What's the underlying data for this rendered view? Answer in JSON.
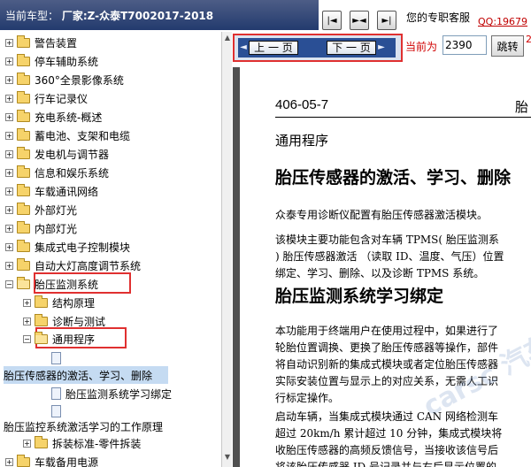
{
  "header": {
    "model_prefix": "当前车型：",
    "model_value": "厂家:Z-众泰T7002017-2018",
    "nav_buttons": [
      {
        "icon": "first-page-icon",
        "glyph": "|◄"
      },
      {
        "icon": "split-view-icon",
        "glyph": "►◄"
      },
      {
        "icon": "last-page-icon",
        "glyph": "►|"
      }
    ],
    "service_label": "您的专职客服",
    "qq": "QQ:19679"
  },
  "tree": {
    "items": [
      {
        "label": "警告装置",
        "expander": "+"
      },
      {
        "label": "停车辅助系统",
        "expander": "+"
      },
      {
        "label": "360°全景影像系统",
        "expander": "+"
      },
      {
        "label": "行车记录仪",
        "expander": "+"
      },
      {
        "label": "充电系统-概述",
        "expander": "+"
      },
      {
        "label": "蓄电池、支架和电缆",
        "expander": "+"
      },
      {
        "label": "发电机与调节器",
        "expander": "+"
      },
      {
        "label": "信息和娱乐系统",
        "expander": "+"
      },
      {
        "label": "车载通讯网络",
        "expander": "+"
      },
      {
        "label": "外部灯光",
        "expander": "+"
      },
      {
        "label": "内部灯光",
        "expander": "+"
      },
      {
        "label": "集成式电子控制模块",
        "expander": "+"
      },
      {
        "label": "自动大灯高度调节系统",
        "expander": "+"
      },
      {
        "label": "胎压监测系统",
        "expander": "−"
      },
      {
        "label": "结构原理",
        "expander": "+"
      },
      {
        "label": "诊断与测试",
        "expander": "+"
      },
      {
        "label": "通用程序",
        "expander": "−"
      },
      {
        "label": "胎压传感器的激活、学习、删除"
      },
      {
        "label": "胎压监测系统学习绑定"
      },
      {
        "label": "胎压监控系统激活学习的工作原理"
      },
      {
        "label": "拆装标准-零件拆装",
        "expander": "+"
      },
      {
        "label": "车载备用电源",
        "expander": "+"
      }
    ]
  },
  "pager": {
    "prev_label": "上 一 页",
    "next_label": "下 一 页",
    "current_label": "当前为",
    "current_page": "2390",
    "jump_label": "跳转",
    "edge_char": "2"
  },
  "document": {
    "code": "406-05-7",
    "code_right": "胎",
    "section": "通用程序",
    "title1": "胎压传感器的激活、学习、删除",
    "p1": "众泰专用诊断仪配置有胎压传感器激活模块。",
    "p2_lines": [
      "该模块主要功能包含对车辆 TPMS( 胎压监测系",
      ") 胎压传感器激活 （读取 ID、温度、气压）位置",
      "绑定、学习、删除、以及诊断 TPMS 系统。"
    ],
    "title2": "胎压监测系统学习绑定",
    "p3_lines": [
      "本功能用于终端用户在使用过程中，如果进行了",
      "轮胎位置调换、更换了胎压传感器等操作，部件",
      "将自动识别新的集成式模块或者定位胎压传感器",
      "实际安装位置与显示上的对应关系，无需人工识",
      "行标定操作。"
    ],
    "p4_lines": [
      "启动车辆，当集成式模块通过 CAN 网络检测车",
      "超过 20km/h 累计超过 10 分钟，集成式模块将",
      "收胎压传感器的高频反馈信号，当接收该信号后",
      "将该胎压传感器 ID 号记录并与右后显示位置的"
    ],
    "watermark": "carsc 汽车"
  }
}
